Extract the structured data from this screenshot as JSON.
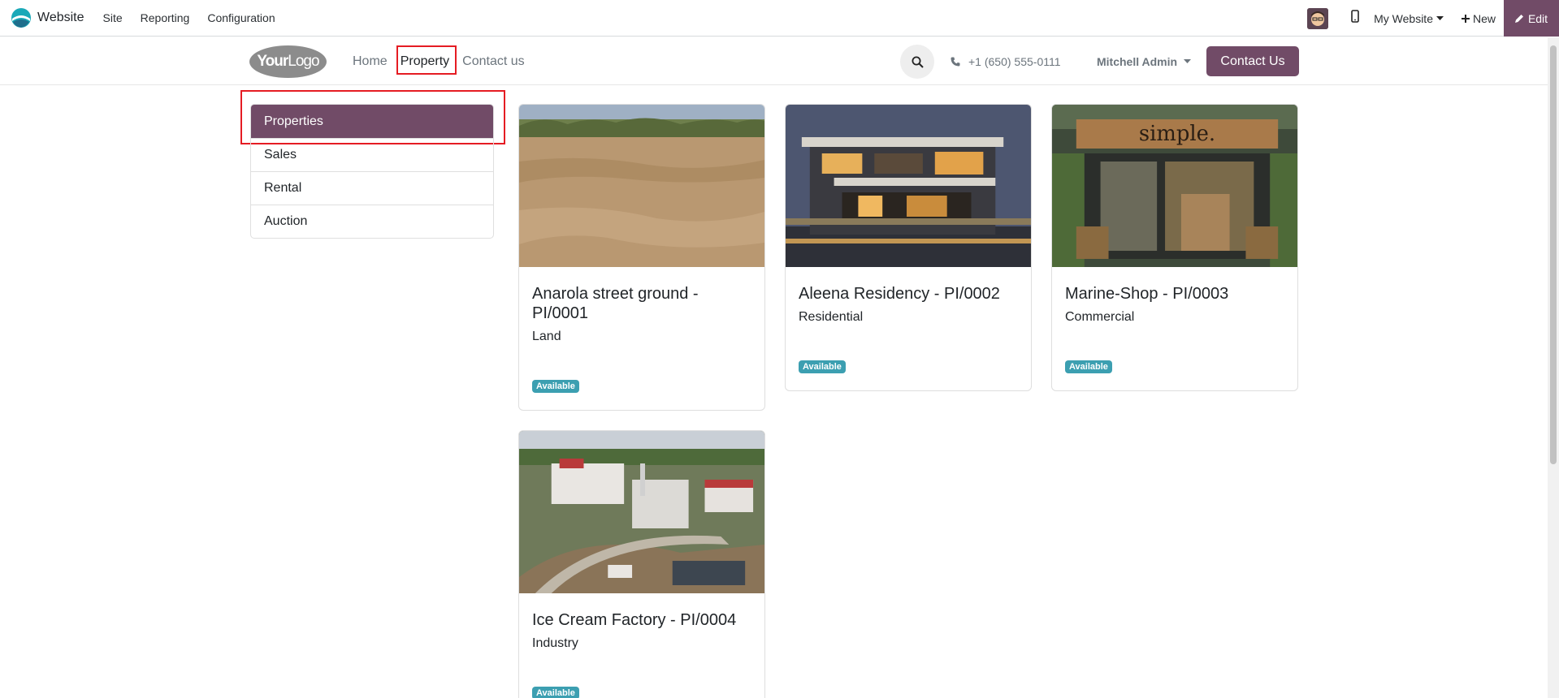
{
  "topbar": {
    "app_name": "Website",
    "menu": [
      "Site",
      "Reporting",
      "Configuration"
    ],
    "site_select": "My Website",
    "new_label": "New",
    "edit_label": "Edit"
  },
  "header": {
    "logo_text_bold": "Your",
    "logo_text": "Logo",
    "nav": [
      "Home",
      "Property",
      "Contact us"
    ],
    "phone": "+1 (650) 555-0111",
    "user": "Mitchell Admin",
    "contact_button": "Contact Us"
  },
  "sidebar": {
    "items": [
      "Properties",
      "Sales",
      "Rental",
      "Auction"
    ]
  },
  "cards": [
    {
      "title": "Anarola street ground - PI/0001",
      "type": "Land",
      "status": "Available",
      "image": "dry-land-photo"
    },
    {
      "title": "Aleena Residency - PI/0002",
      "type": "Residential",
      "status": "Available",
      "image": "modern-house-photo"
    },
    {
      "title": "Marine-Shop - PI/0003",
      "type": "Commercial",
      "status": "Available",
      "image": "shop-front-photo"
    },
    {
      "title": "Ice Cream Factory - PI/0004",
      "type": "Industry",
      "status": "Available",
      "image": "factory-aerial-photo"
    }
  ],
  "colors": {
    "brand": "#714b67",
    "badge": "#3c9fb1",
    "highlight": "#e51c23"
  }
}
